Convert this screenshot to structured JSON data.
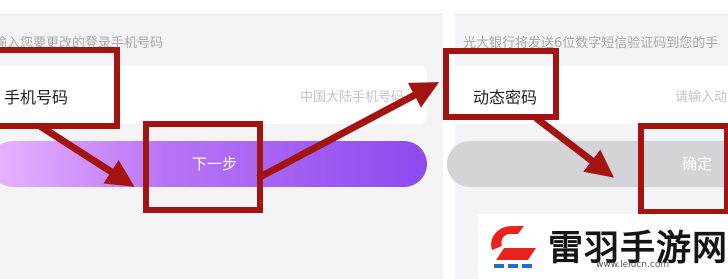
{
  "left": {
    "hint": "输入您要更改的登录手机号码",
    "field_label": "手机号码",
    "field_placeholder": "中国大陆手机号码",
    "next_label": "下一步"
  },
  "right": {
    "hint": "光大银行将发送6位数字短信验证码到您的手",
    "field_label": "动态密码",
    "field_placeholder": "请输入动",
    "confirm_label": "确定"
  },
  "watermark": {
    "name": "雷羽手游网",
    "url": "www.leiucn.com"
  },
  "colors": {
    "annotation_red": "#a3130f",
    "button_gradient_start": "#e8b6ff",
    "button_gradient_end": "#8c4af0",
    "disabled_button": "#d3d3d8"
  }
}
